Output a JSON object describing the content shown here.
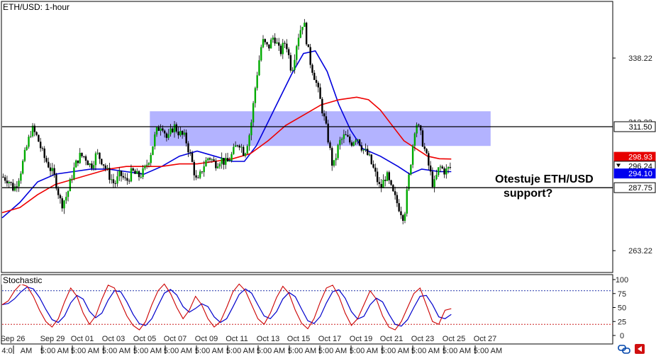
{
  "chart_data": {
    "type": "candlestick",
    "title": "ETH/USD: 1-hour",
    "price_axis": {
      "range": [
        255,
        360
      ],
      "ticks": [
        "338.22",
        "263.22"
      ],
      "faded_ticks": [
        "313.22"
      ]
    },
    "x_axis": {
      "date_labels": [
        "Sep 26",
        "Sep 29",
        "Oct 01",
        "Oct 03",
        "Oct 05",
        "Oct 07",
        "Oct 09",
        "Oct 11",
        "Oct 13",
        "Oct 15",
        "Oct 17",
        "Oct 19",
        "Oct 21",
        "Oct 23",
        "Oct 25",
        "Oct 27"
      ],
      "time_labels": [
        "4:0",
        "AM",
        "5:00 AM",
        "5:00 AM",
        "5:00 AM",
        "5:00 AM",
        "5:00 AM",
        "5:00 AM",
        "5:00 AM",
        "5:00 AM",
        "5:00 AM",
        "5:00 AM",
        "5:00 AM",
        "5:00 AM",
        "5:00 AM",
        "5:00 AM",
        "5:00 AM"
      ]
    },
    "levels": [
      {
        "label": "311.50",
        "value": 311.5,
        "color": "#000000"
      },
      {
        "label": "287.75",
        "value": 287.75,
        "color": "#000000"
      }
    ],
    "zone": {
      "from": 304.0,
      "to": 317.5,
      "color": "#9999ff"
    },
    "price_tags": [
      {
        "label": "298.93",
        "value": 298.93,
        "color": "#e60000"
      },
      {
        "label": "296.24",
        "value": 296.24,
        "color": "#ffffff"
      },
      {
        "label": "294.10",
        "value": 294.1,
        "color": "#0000ee"
      }
    ],
    "annotation": {
      "line1": "Otestuje ETH/USD",
      "line2": "support?"
    },
    "price_series": [
      [
        0,
        292
      ],
      [
        3,
        291
      ],
      [
        6,
        287
      ],
      [
        9,
        293
      ],
      [
        12,
        302
      ],
      [
        15,
        311
      ],
      [
        18,
        307
      ],
      [
        21,
        300
      ],
      [
        24,
        296
      ],
      [
        27,
        291
      ],
      [
        30,
        281
      ],
      [
        33,
        285
      ],
      [
        36,
        294
      ],
      [
        39,
        300
      ],
      [
        42,
        300
      ],
      [
        45,
        296
      ],
      [
        48,
        301
      ],
      [
        51,
        298
      ],
      [
        54,
        293
      ],
      [
        57,
        289
      ],
      [
        60,
        293
      ],
      [
        63,
        290
      ],
      [
        66,
        294
      ],
      [
        69,
        292
      ],
      [
        72,
        294
      ],
      [
        75,
        300
      ],
      [
        78,
        309
      ],
      [
        81,
        313
      ],
      [
        84,
        306
      ],
      [
        87,
        312
      ],
      [
        90,
        309
      ],
      [
        93,
        307
      ],
      [
        96,
        299
      ],
      [
        99,
        289
      ],
      [
        102,
        296
      ],
      [
        105,
        300
      ],
      [
        108,
        297
      ],
      [
        111,
        299
      ],
      [
        114,
        297
      ],
      [
        117,
        301
      ],
      [
        120,
        306
      ],
      [
        123,
        301
      ],
      [
        126,
        310
      ],
      [
        129,
        330
      ],
      [
        132,
        345
      ],
      [
        135,
        342
      ],
      [
        138,
        347
      ],
      [
        141,
        340
      ],
      [
        144,
        345
      ],
      [
        147,
        333
      ],
      [
        150,
        346
      ],
      [
        153,
        353
      ],
      [
        156,
        338
      ],
      [
        159,
        330
      ],
      [
        162,
        320
      ],
      [
        165,
        309
      ],
      [
        168,
        295
      ],
      [
        171,
        305
      ],
      [
        174,
        308
      ],
      [
        177,
        305
      ],
      [
        180,
        308
      ],
      [
        183,
        303
      ],
      [
        186,
        300
      ],
      [
        189,
        294
      ],
      [
        192,
        287
      ],
      [
        195,
        293
      ],
      [
        198,
        286
      ],
      [
        201,
        281
      ],
      [
        204,
        276
      ],
      [
        207,
        295
      ],
      [
        210,
        314
      ],
      [
        213,
        307
      ],
      [
        216,
        298
      ],
      [
        219,
        288
      ],
      [
        222,
        296
      ],
      [
        225,
        294
      ],
      [
        228,
        296
      ]
    ],
    "series": [
      {
        "color": "#0000dd",
        "points": [
          [
            0,
            276
          ],
          [
            9,
            282
          ],
          [
            18,
            290
          ],
          [
            27,
            293
          ],
          [
            36,
            294
          ],
          [
            45,
            295
          ],
          [
            54,
            295
          ],
          [
            63,
            294
          ],
          [
            72,
            293
          ],
          [
            81,
            296
          ],
          [
            90,
            300
          ],
          [
            99,
            302
          ],
          [
            108,
            300
          ],
          [
            117,
            298
          ],
          [
            123,
            298
          ],
          [
            129,
            304
          ],
          [
            138,
            318
          ],
          [
            147,
            332
          ],
          [
            153,
            340
          ],
          [
            159,
            341
          ],
          [
            165,
            333
          ],
          [
            171,
            320
          ],
          [
            177,
            310
          ],
          [
            183,
            303
          ],
          [
            192,
            300
          ],
          [
            201,
            296
          ],
          [
            207,
            293
          ],
          [
            213,
            295
          ],
          [
            222,
            294
          ],
          [
            228,
            294
          ]
        ]
      },
      {
        "color": "#ee0000",
        "points": [
          [
            0,
            278
          ],
          [
            9,
            280
          ],
          [
            18,
            285
          ],
          [
            27,
            289
          ],
          [
            36,
            291
          ],
          [
            45,
            293
          ],
          [
            54,
            295
          ],
          [
            63,
            296
          ],
          [
            72,
            296
          ],
          [
            81,
            296
          ],
          [
            90,
            297
          ],
          [
            99,
            297
          ],
          [
            108,
            298
          ],
          [
            117,
            299
          ],
          [
            126,
            301
          ],
          [
            135,
            306
          ],
          [
            144,
            312
          ],
          [
            153,
            316
          ],
          [
            162,
            320
          ],
          [
            171,
            322
          ],
          [
            180,
            323
          ],
          [
            186,
            322
          ],
          [
            192,
            318
          ],
          [
            198,
            312
          ],
          [
            204,
            306
          ],
          [
            210,
            303
          ],
          [
            216,
            300
          ],
          [
            222,
            299
          ],
          [
            228,
            298.9
          ]
        ]
      }
    ],
    "stochastic": {
      "title": "Stochastic",
      "range": [
        0,
        100
      ],
      "ticks": [
        "100",
        "75",
        "50",
        "25",
        "0"
      ],
      "overbought": 80,
      "oversold": 20,
      "k_color": "#cc0000",
      "d_color": "#0000cc",
      "k_values": [
        55,
        62,
        80,
        92,
        88,
        70,
        45,
        25,
        15,
        30,
        60,
        85,
        70,
        40,
        20,
        35,
        65,
        90,
        85,
        60,
        35,
        18,
        10,
        25,
        55,
        80,
        92,
        75,
        50,
        30,
        45,
        70,
        55,
        30,
        15,
        25,
        50,
        78,
        92,
        80,
        55,
        30,
        20,
        40,
        68,
        88,
        75,
        45,
        22,
        12,
        30,
        60,
        85,
        90,
        70,
        40,
        18,
        30,
        55,
        80,
        65,
        35,
        15,
        10,
        25,
        50,
        75,
        85,
        55,
        25,
        20,
        45,
        48
      ]
    }
  }
}
